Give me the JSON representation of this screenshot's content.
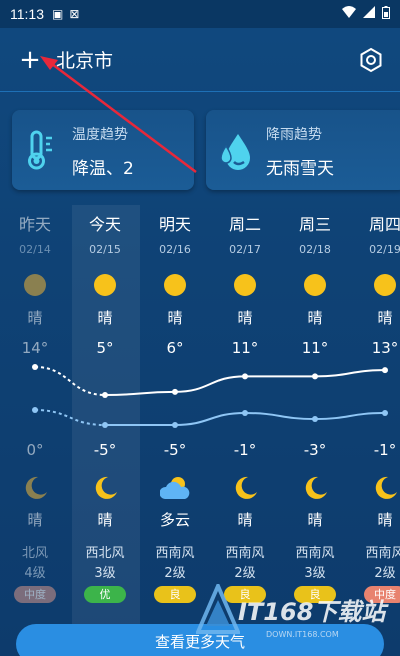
{
  "status": {
    "time": "11:13"
  },
  "header": {
    "city": "北京市",
    "add_symbol": "+"
  },
  "cards": [
    {
      "title": "温度趋势",
      "value": "降温、2",
      "icon": "thermometer-icon"
    },
    {
      "title": "降雨趋势",
      "value": "无雨雪天",
      "icon": "raindrops-icon"
    }
  ],
  "days": [
    {
      "weekday": "昨天",
      "date": "02/14",
      "day_cond": "晴",
      "high": "14°",
      "low": "0°",
      "night_cond": "晴",
      "wind_dir": "北风",
      "wind_level": "4级",
      "aqi": "中度",
      "aqi_color": "#c58f86",
      "day_icon": "sun-icon",
      "night_icon": "moon-icon"
    },
    {
      "weekday": "今天",
      "date": "02/15",
      "day_cond": "晴",
      "high": "5°",
      "low": "-5°",
      "night_cond": "晴",
      "wind_dir": "西北风",
      "wind_level": "3级",
      "aqi": "优",
      "aqi_color": "#3cb44a",
      "day_icon": "sun-icon",
      "night_icon": "moon-icon"
    },
    {
      "weekday": "明天",
      "date": "02/16",
      "day_cond": "晴",
      "high": "6°",
      "low": "-5°",
      "night_cond": "多云",
      "wind_dir": "西南风",
      "wind_level": "2级",
      "aqi": "良",
      "aqi_color": "#e9c21a",
      "day_icon": "sun-icon",
      "night_icon": "cloudy-night-icon"
    },
    {
      "weekday": "周二",
      "date": "02/17",
      "day_cond": "晴",
      "high": "11°",
      "low": "-1°",
      "night_cond": "晴",
      "wind_dir": "西南风",
      "wind_level": "2级",
      "aqi": "良",
      "aqi_color": "#e9c21a",
      "day_icon": "sun-icon",
      "night_icon": "moon-icon"
    },
    {
      "weekday": "周三",
      "date": "02/18",
      "day_cond": "晴",
      "high": "11°",
      "low": "-3°",
      "night_cond": "晴",
      "wind_dir": "西南风",
      "wind_level": "3级",
      "aqi": "良",
      "aqi_color": "#e9c21a",
      "day_icon": "sun-icon",
      "night_icon": "moon-icon"
    },
    {
      "weekday": "周四",
      "date": "02/19",
      "day_cond": "晴",
      "high": "13°",
      "low": "-1°",
      "night_cond": "晴",
      "wind_dir": "西南风",
      "wind_level": "2级",
      "aqi": "中度",
      "aqi_color": "#e8836f",
      "day_icon": "sun-icon",
      "night_icon": "moon-icon"
    }
  ],
  "more_button": "查看更多天气",
  "watermark": {
    "brand": "IT168下载站",
    "sub": "DOWN.IT168.COM"
  },
  "colors": {
    "accent": "#2a8ee2",
    "sun": "#f7c21b",
    "background": "#0f4275"
  }
}
